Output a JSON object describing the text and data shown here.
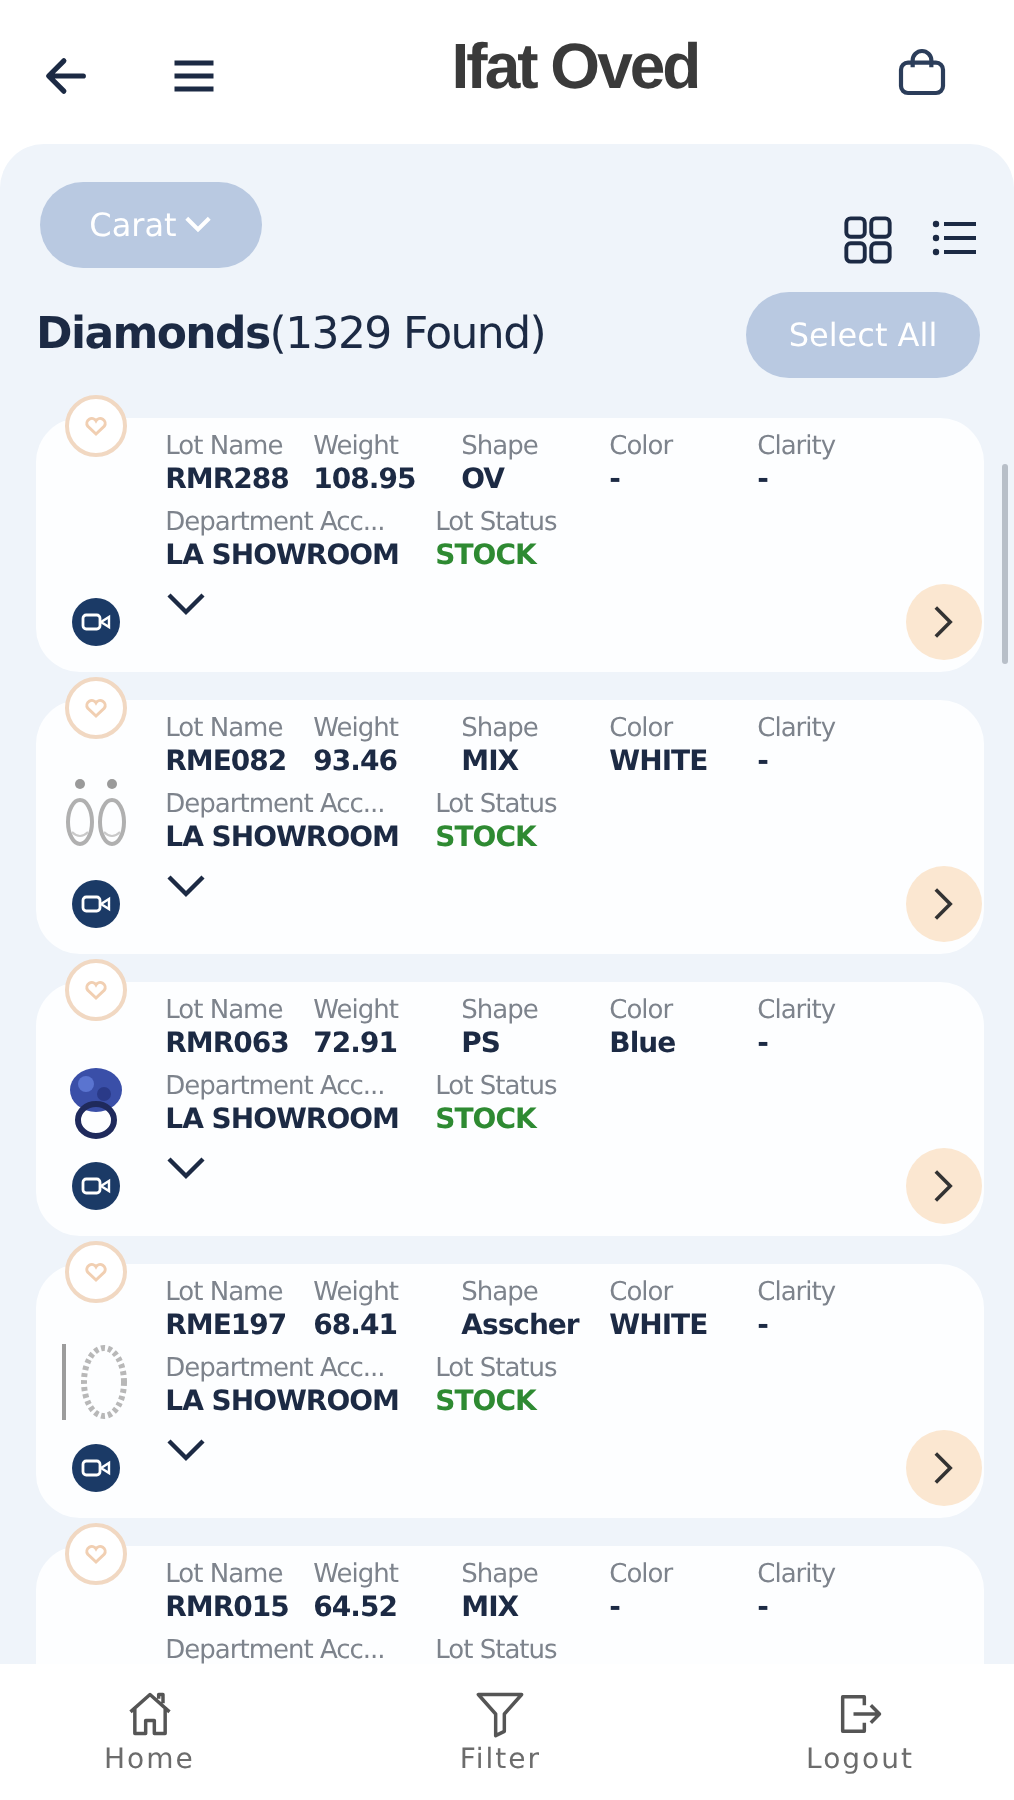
{
  "header": {
    "title": "Ifat Oved"
  },
  "toolbar": {
    "filter_button": "Carat",
    "heading": "**Diamonds**(1329 Found)",
    "select_all": "Select All"
  },
  "items": [
    {
      "photo": false,
      "fields": [
        {
          "label": "Lot Name",
          "value": "RMR288"
        },
        {
          "label": "Weight",
          "value": "108.95"
        },
        {
          "label": "Shape",
          "value": "OV"
        },
        {
          "label": "Color",
          "value": "-"
        },
        {
          "label": "Clarity",
          "value": "-"
        }
      ],
      "details": [
        {
          "label": "Department Acc...",
          "value": "LA SHOWROOM"
        },
        {
          "label": "Lot Status",
          "value": "STOCK",
          "kind": "status"
        }
      ]
    },
    {
      "photo": true,
      "fields": [
        {
          "label": "Lot Name",
          "value": "RME082"
        },
        {
          "label": "Weight",
          "value": "93.46"
        },
        {
          "label": "Shape",
          "value": "MIX"
        },
        {
          "label": "Color",
          "value": "WHITE"
        },
        {
          "label": "Clarity",
          "value": "-"
        }
      ],
      "details": [
        {
          "label": "Department Acc...",
          "value": "LA SHOWROOM"
        },
        {
          "label": "Lot Status",
          "value": "STOCK",
          "kind": "status"
        }
      ]
    },
    {
      "photo": true,
      "fields": [
        {
          "label": "Lot Name",
          "value": "RMR063"
        },
        {
          "label": "Weight",
          "value": "72.91"
        },
        {
          "label": "Shape",
          "value": "PS"
        },
        {
          "label": "Color",
          "value": "Blue"
        },
        {
          "label": "Clarity",
          "value": "-"
        }
      ],
      "details": [
        {
          "label": "Department Acc...",
          "value": "LA SHOWROOM"
        },
        {
          "label": "Lot Status",
          "value": "STOCK",
          "kind": "status"
        }
      ]
    },
    {
      "photo": true,
      "fields": [
        {
          "label": "Lot Name",
          "value": "RME197"
        },
        {
          "label": "Weight",
          "value": "68.41"
        },
        {
          "label": "Shape",
          "value": "Asscher"
        },
        {
          "label": "Color",
          "value": "WHITE"
        },
        {
          "label": "Clarity",
          "value": "-"
        }
      ],
      "details": [
        {
          "label": "Department Acc...",
          "value": "LA SHOWROOM"
        },
        {
          "label": "Lot Status",
          "value": "STOCK",
          "kind": "status"
        }
      ]
    },
    {
      "photo": false,
      "fields": [
        {
          "label": "Lot Name",
          "value": "RMR015"
        },
        {
          "label": "Weight",
          "value": "64.52"
        },
        {
          "label": "Shape",
          "value": "MIX"
        },
        {
          "label": "Color",
          "value": "-"
        },
        {
          "label": "Clarity",
          "value": "-"
        }
      ],
      "details": [
        {
          "label": "Department Acc..."
        },
        {
          "label": "Lot Status"
        }
      ]
    }
  ],
  "nav": [
    {
      "kind": "home",
      "label": "Home"
    },
    {
      "kind": "filter",
      "label": "Filter"
    },
    {
      "kind": "logout",
      "label": "Logout"
    }
  ]
}
